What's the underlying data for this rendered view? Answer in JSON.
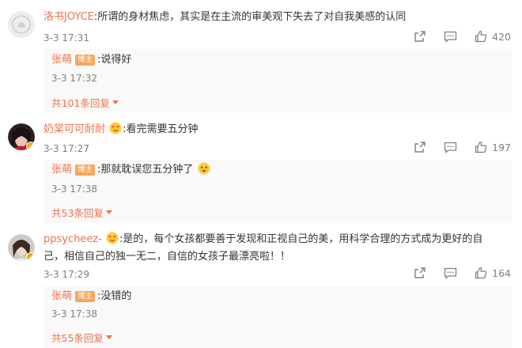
{
  "comments": [
    {
      "user": "洛书JOYCE",
      "text": ":所谓的身材焦虑，其实是在主流的审美观下失去了对自我美感的认同",
      "time": "3-3 17:31",
      "likes": "420",
      "reply": {
        "user": "张萌",
        "tag": "博主",
        "text": ":说得好",
        "time": "3-3 17:32",
        "more": "共101条回复"
      }
    },
    {
      "user": "奶棠可可耐耐",
      "text": ":看完需要五分钟",
      "time": "3-3 17:27",
      "likes": "197",
      "reply": {
        "user": "张萌",
        "tag": "博主",
        "text": ":那就耽误您五分钟了",
        "time": "3-3 17:38",
        "more": "共53条回复"
      }
    },
    {
      "user": "ppsycheez-",
      "text": ":是的，每个女孩都要善于发现和正视自己的美，用科学合理的方式成为更好的自己，相信自己的独一无二，自信的女孩子最漂亮啦！！",
      "time": "3-3 17:29",
      "likes": "164",
      "reply": {
        "user": "张萌",
        "tag": "博主",
        "text": ":没错的",
        "time": "3-3 17:38",
        "more": "共55条回复"
      }
    }
  ],
  "icons": {
    "forward": "forward-icon",
    "comment": "comment-icon",
    "like": "thumbs-up-icon",
    "emoji": "emoji-icon",
    "verified": "verified-badge-icon"
  },
  "colors": {
    "username": "#eb7350",
    "tag": "#f7a55f",
    "meta": "#808080",
    "reply_bg": "#f9f9f9"
  }
}
